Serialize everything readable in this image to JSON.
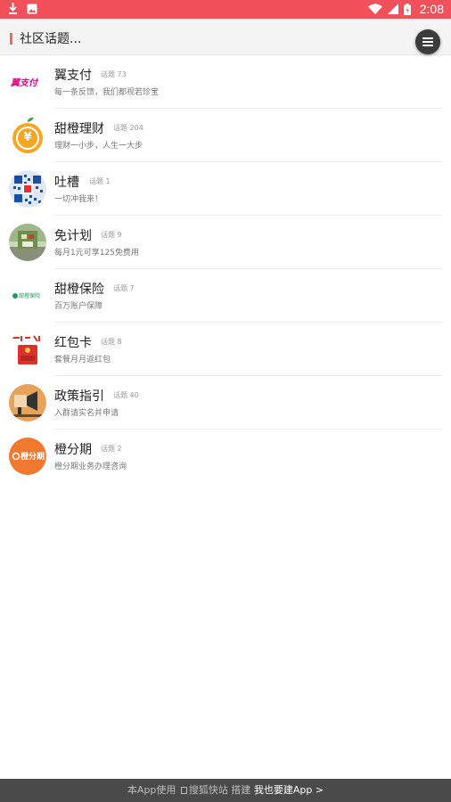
{
  "status_bar": {
    "time": "2:08"
  },
  "header": {
    "title": "社区话题..."
  },
  "topics": [
    {
      "title": "翼支付",
      "count": "话题 73",
      "desc": "每一条反馈，我们都视若珍宝",
      "logo_text": "翼支付",
      "color": "#e4007f"
    },
    {
      "title": "甜橙理财",
      "count": "话题 204",
      "desc": "理财一小步，人生一大步",
      "logo_text": "¥",
      "color": "#f5a623"
    },
    {
      "title": "吐槽",
      "count": "话题 1",
      "desc": "一切冲我来！",
      "color": "#1a4fa3"
    },
    {
      "title": "免计划",
      "count": "话题 9",
      "desc": "每月1元可享125免费用",
      "color": "#6e8f4d"
    },
    {
      "title": "甜橙保险",
      "count": "话题 7",
      "desc": "百万账户保障",
      "logo_text": "甜橙保险",
      "color": "#1e9a5e"
    },
    {
      "title": "红包卡",
      "count": "话题 8",
      "desc": "套餐月月返红包",
      "color": "#d9322a"
    },
    {
      "title": "政策指引",
      "count": "话题 40",
      "desc": "入群请实名并申请",
      "color": "#e7a25c"
    },
    {
      "title": "橙分期",
      "count": "话题 2",
      "desc": "橙分期业务办理咨询",
      "logo_text": "橙分期",
      "color": "#f0782f"
    }
  ],
  "footer": {
    "prefix": "本App使用",
    "brand": "搜狐快站",
    "middle": "搭建",
    "cta": "我也要建App >"
  }
}
